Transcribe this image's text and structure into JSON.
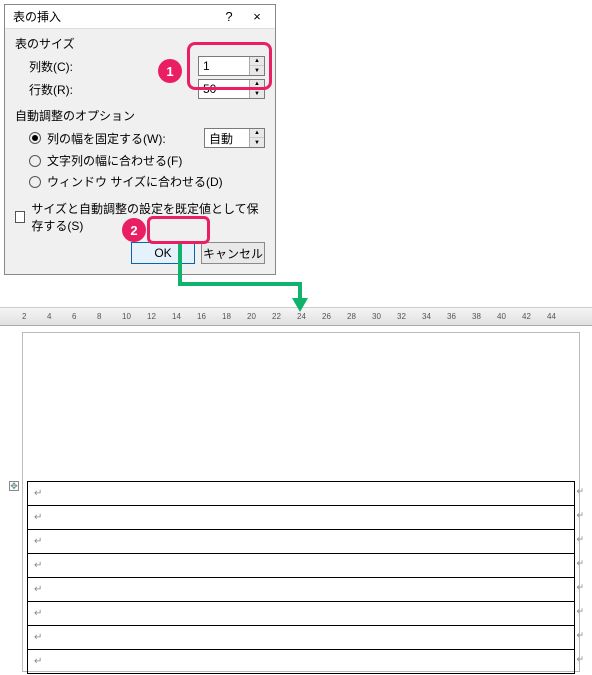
{
  "dialog": {
    "title": "表の挿入",
    "help": "?",
    "close": "×",
    "size_section": "表のサイズ",
    "cols_label": "列数(C):",
    "rows_label": "行数(R):",
    "cols_value": "1",
    "rows_value": "50",
    "autofit_section": "自動調整のオプション",
    "radio_fixed": "列の幅を固定する(W):",
    "radio_content": "文字列の幅に合わせる(F)",
    "radio_window": "ウィンドウ サイズに合わせる(D)",
    "auto_value": "自動",
    "save_default": "サイズと自動調整の設定を既定値として保存する(S)",
    "ok": "OK",
    "cancel": "キャンセル"
  },
  "badges": {
    "b1": "1",
    "b2": "2"
  },
  "ruler": {
    "numbers": [
      2,
      4,
      6,
      8,
      10,
      12,
      14,
      16,
      18,
      20,
      22,
      24,
      26,
      28,
      30,
      32,
      34,
      36,
      38,
      40,
      42,
      44
    ]
  },
  "table": {
    "rowmark": "↵",
    "anchor": "✥",
    "rows": 8
  }
}
